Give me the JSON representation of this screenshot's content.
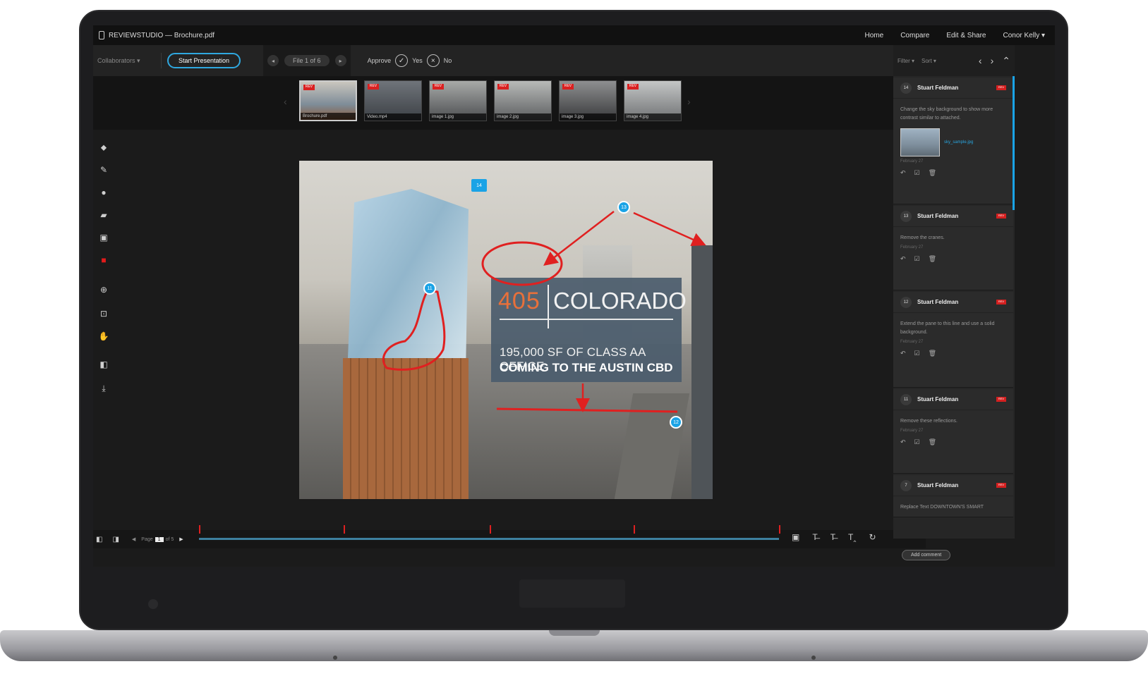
{
  "app": {
    "title": "REVIEWSTUDIO — Brochure.pdf",
    "nav": [
      "Home",
      "Compare",
      "Edit & Share",
      "Conor Kelly ▾"
    ]
  },
  "toolbar": {
    "collaborators": "Collaborators ▾",
    "start_presentation": "Start Presentation",
    "file_indicator": "File 1 of 6",
    "approve_label": "Approve",
    "yes_label": "Yes",
    "no_label": "No"
  },
  "thumbnails": [
    {
      "caption": "Brochure.pdf",
      "badge": "REV"
    },
    {
      "caption": "Video.mp4",
      "badge": "REV"
    },
    {
      "caption": "image 1.jpg",
      "badge": "REV"
    },
    {
      "caption": "image 2.jpg",
      "badge": "REV"
    },
    {
      "caption": "image 3.jpg",
      "badge": "REV"
    },
    {
      "caption": "image 4.jpg",
      "badge": "REV"
    }
  ],
  "artwork": {
    "number": "405",
    "name": "COLORADO",
    "line1": "195,000 SF OF CLASS AA OFFICE",
    "line2": "COMING TO THE AUSTIN CBD",
    "pins": [
      "14",
      "13",
      "11",
      "12"
    ]
  },
  "bottombar": {
    "page_label": "Page",
    "page_value": "1",
    "page_total": "of 5"
  },
  "panel": {
    "filter": "Filter ▾",
    "sort": "Sort ▾",
    "add_comment": "Add comment",
    "comments": [
      {
        "num": "14",
        "author": "Stuart Feldman",
        "badge": "REV",
        "text": "Change the sky background to show more contrast similar to attached.",
        "attachment": "sky_sample.jpg",
        "date": "February 27"
      },
      {
        "num": "13",
        "author": "Stuart Feldman",
        "badge": "REV",
        "text": "Remove the cranes.",
        "date": "February 27"
      },
      {
        "num": "12",
        "author": "Stuart Feldman",
        "badge": "REV",
        "text": "Extend the pane to this line and use a solid background.",
        "date": "February 27"
      },
      {
        "num": "11",
        "author": "Stuart Feldman",
        "badge": "REV",
        "text": "Remove these reflections.",
        "date": "February 27"
      },
      {
        "num": "7",
        "author": "Stuart Feldman",
        "badge": "REV",
        "text": "Replace Text DOWNTOWN'S SMART"
      }
    ]
  },
  "colors": {
    "accent": "#1aa3e6",
    "markup_red": "#e02020",
    "title_orange": "#e8703a"
  }
}
